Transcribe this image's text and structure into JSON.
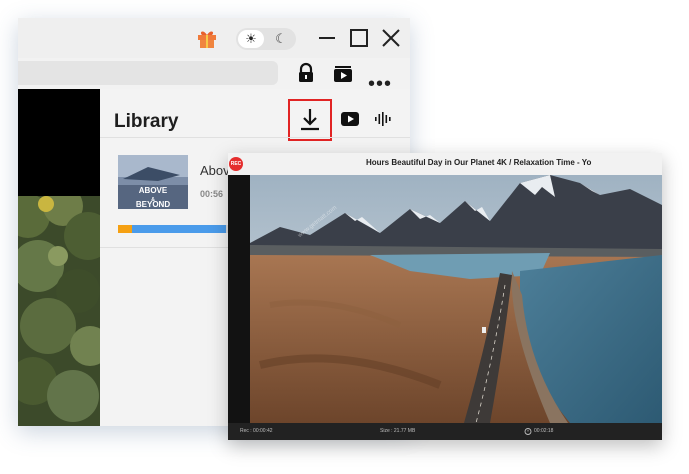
{
  "browser": {
    "toolbar": {
      "more_label": "•••"
    },
    "theme_toggle": {
      "sun": "☀",
      "moon": "☾"
    }
  },
  "library": {
    "title": "Library",
    "item": {
      "title": "Above",
      "duration": "00:56",
      "thumbnail_text": "ABOVE & BEYOND",
      "progress": 0.36
    }
  },
  "recorder": {
    "badge": "REC",
    "title": "Hours Beautiful Day in Our Planet 4K / Relaxation Time - Yo",
    "status": {
      "rec_time": "Rec : 00:00:42",
      "size": "Size : 21.77 MB",
      "timer": "00:02:18"
    },
    "watermark": "www.getmatt.com"
  },
  "colors": {
    "highlight": "#e12424",
    "progress_fill": "#4a9bea",
    "progress_head": "#f5a012",
    "rec_badge": "#e52d2d"
  }
}
